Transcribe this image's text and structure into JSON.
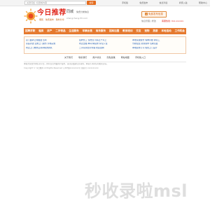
{
  "topbar": {
    "search_placeholder": "关键词如: 标题或内容",
    "search_button": "搜索",
    "links": [
      "手机版",
      "免费发布",
      "信息列表",
      "商家入驻",
      "帮助中心"
    ]
  },
  "header": {
    "logo_text": "今日推荐",
    "logo_slogan": "便民 · 免费发布 · 随时分享",
    "city_name": "同城",
    "city_tag": "免费分类信息",
    "city_domain": "shangcheng.ttt.com",
    "publish_button": "免费发布信息",
    "manage_link": "信息管理 | 修改",
    "hotline": "客服热线: 0xx-xxxxxx"
  },
  "nav": {
    "items": [
      "招聘求职",
      "租房",
      "房产",
      "二手物品",
      "生活服务",
      "车辆出售",
      "商务服务",
      "招商加盟",
      "教育培训",
      "交友",
      "宠物",
      "旅游",
      "本地活动",
      "工作机会"
    ]
  },
  "notices": {
    "col1": [
      "店门面转让免租金 急转",
      "家庭清洁 全屋上门服务 价格实惠",
      "附近上门维修空调冰箱洗衣机"
    ],
    "col2": [
      "招聘普工 包吃住 月薪五千以上",
      "附近出租 单间 精装修 拎包入住",
      "二手家具低价处理 欢迎选购"
    ],
    "col3": [
      "本地家政服务 保姆月嫂 钟点工",
      "驾校招生 随到随学 包教包会",
      "本地装修公司 免费上门设计"
    ]
  },
  "help": {
    "links": [
      "关于我们",
      "联系我们",
      "用户协议",
      "隐私政策",
      "网站地图",
      "手机版入口"
    ]
  },
  "footer": {
    "line1": "本站为免费分类信息平台，所有信息均由用户发布，请注意甄别信息真伪，本站不承担任何相关责任。",
    "line2": "Copyright © 今日推荐 All Rights Reserved  京ICP备xxxxxxxx号  备案号 xxxxxxxxxx"
  },
  "watermark": {
    "text": "秒收录啦msl"
  },
  "colors": {
    "accent": "#e5792e",
    "logo_red": "#e02a1f",
    "link_blue": "#2a64b8"
  }
}
